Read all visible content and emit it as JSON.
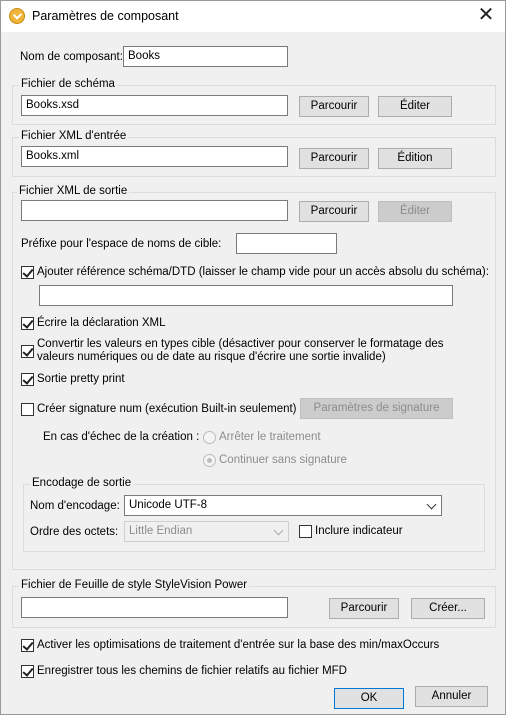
{
  "window": {
    "title": "Paramètres de composant"
  },
  "component": {
    "name_label": "Nom de composant:",
    "name_value": "Books"
  },
  "schema": {
    "group_title": "Fichier de schéma",
    "value": "Books.xsd",
    "browse_label": "Parcourir",
    "edit_label": "Éditer"
  },
  "input_xml": {
    "group_title": "Fichier XML d'entrée",
    "value": "Books.xml",
    "browse_label": "Parcourir",
    "edit_label": "Édition"
  },
  "output_xml": {
    "group_title": "Fichier XML de sortie",
    "value": "",
    "browse_label": "Parcourir",
    "edit_label": "Éditer",
    "prefix_label": "Préfixe pour l'espace de noms de cible:",
    "prefix_value": "",
    "add_schema_ref_label": "Ajouter référence schéma/DTD (laisser le champ vide pour un accès absolu du schéma):",
    "schema_ref_value": "",
    "write_xml_decl_label": "Écrire la déclaration XML",
    "convert_values_line1": "Convertir les valeurs en types cible (désactiver pour conserver le formatage des",
    "convert_values_line2": "valeurs numériques ou de date au risque d'écrire une sortie invalide)",
    "pretty_print_label": "Sortie pretty print",
    "digital_signature_label": "Créer signature num (exécution Built-in seulement)",
    "signature_settings_label": "Paramètres de signature",
    "on_failure_label": "En cas d'échec de la création :",
    "stop_processing_label": "Arrêter le traitement",
    "continue_without_label": "Continuer sans signature",
    "encoding": {
      "group_title": "Encodage de sortie",
      "name_label": "Nom d'encodage:",
      "name_value": "Unicode UTF-8",
      "byte_order_label": "Ordre des octets:",
      "byte_order_value": "Little Endian",
      "include_bom_label": "Inclure indicateur"
    }
  },
  "stylevision": {
    "group_title": "Fichier de Feuille de style StyleVision Power",
    "value": "",
    "browse_label": "Parcourir",
    "create_label": "Créer..."
  },
  "options": {
    "minmax_label": "Activer les optimisations de traitement d'entrée sur la base des min/maxOccurs",
    "relative_paths_label": "Enregistrer tous les chemins de fichier relatifs au fichier MFD"
  },
  "footer": {
    "ok_label": "OK",
    "cancel_label": "Annuler"
  }
}
